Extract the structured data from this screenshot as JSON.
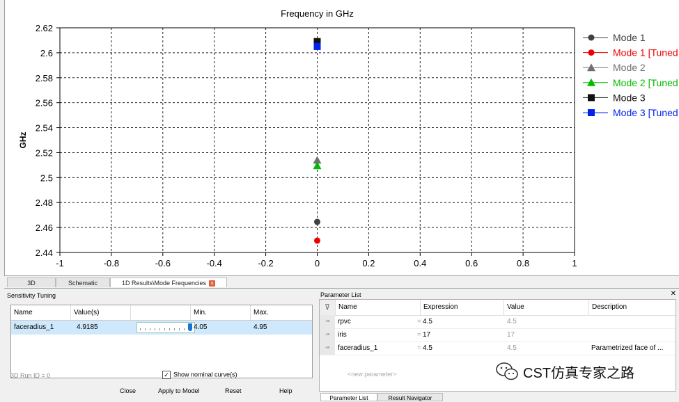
{
  "chart_data": {
    "type": "scatter",
    "title": "Frequency in GHz",
    "ylabel": "GHz",
    "xlabel": "",
    "xlim": [
      -1,
      1
    ],
    "ylim": [
      2.44,
      2.62
    ],
    "x_ticks": [
      "-1",
      "-0.8",
      "-0.6",
      "-0.4",
      "-0.2",
      "0",
      "0.2",
      "0.4",
      "0.6",
      "0.8",
      "1"
    ],
    "y_ticks": [
      "2.44",
      "2.46",
      "2.48",
      "2.5",
      "2.52",
      "2.54",
      "2.56",
      "2.58",
      "2.6",
      "2.62"
    ],
    "grid": true,
    "legend_position": "right",
    "series": [
      {
        "name": "Mode 1",
        "color": "#404040",
        "marker": "circle",
        "x": [
          0
        ],
        "y": [
          2.4645
        ]
      },
      {
        "name": "Mode 1 [Tuned",
        "color": "#ee0000",
        "marker": "circle",
        "x": [
          0
        ],
        "y": [
          2.4495
        ]
      },
      {
        "name": "Mode 2",
        "color": "#707070",
        "marker": "triangle",
        "x": [
          0
        ],
        "y": [
          2.514
        ]
      },
      {
        "name": "Mode 2 [Tuned",
        "color": "#00bb00",
        "marker": "triangle",
        "x": [
          0
        ],
        "y": [
          2.5095
        ]
      },
      {
        "name": "Mode 3",
        "color": "#111111",
        "marker": "square",
        "x": [
          0
        ],
        "y": [
          2.609
        ]
      },
      {
        "name": "Mode 3 [Tuned",
        "color": "#0022ee",
        "marker": "square",
        "x": [
          0
        ],
        "y": [
          2.605
        ]
      }
    ]
  },
  "tabs": [
    {
      "label": "3D"
    },
    {
      "label": "Schematic"
    },
    {
      "label": "1D Results\\Mode Frequencies"
    }
  ],
  "sensitivity": {
    "title": "Sensitivity Tuning",
    "headers": [
      "Name",
      "Value(s)",
      "",
      "Min.",
      "Max."
    ],
    "row": {
      "name": "faceradius_1",
      "value": "4.9185",
      "min": "4.05",
      "max": "4.95",
      "slider_fraction": 0.96
    },
    "run_id": "3D Run ID = 0",
    "show_nominal": "Show nominal curve(s)",
    "show_nominal_checked": true,
    "buttons": {
      "close": "Close",
      "apply": "Apply to Model",
      "reset": "Reset",
      "help": "Help"
    }
  },
  "parameters": {
    "title": "Parameter List",
    "headers": [
      "Name",
      "Expression",
      "Value",
      "Description"
    ],
    "rows": [
      {
        "name": "rpvc",
        "expression": "4.5",
        "value": "4.5",
        "description": ""
      },
      {
        "name": "iris",
        "expression": "17",
        "value": "17",
        "description": ""
      },
      {
        "name": "faceradius_1",
        "expression": "4.5",
        "value": "4.5",
        "description": "Parametrized face of ..."
      }
    ],
    "new_param": "<new parameter>",
    "bottom_tabs": [
      "Parameter List",
      "Result Navigator"
    ]
  },
  "watermark": "CST仿真专家之路"
}
